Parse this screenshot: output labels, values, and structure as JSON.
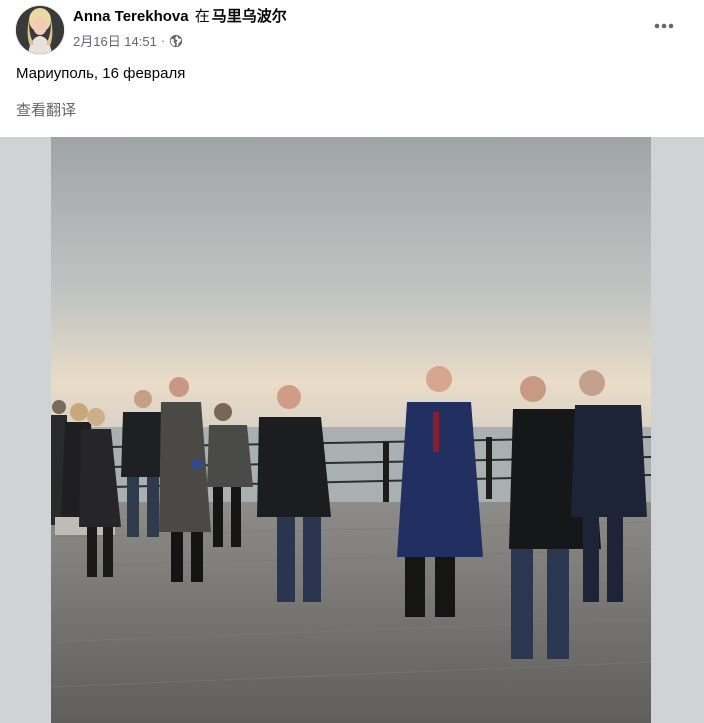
{
  "post": {
    "author": "Anna Terekhova",
    "in_word": "在",
    "location": "马里乌波尔",
    "date": "2月16日 14:51",
    "separator": "·",
    "privacy_icon": "globe-icon",
    "more_icon": "more-horizontal-icon",
    "text": "Мариуполь, 16 февраля",
    "translate_label": "查看翻译"
  },
  "colors": {
    "secondary_text": "#65676b",
    "primary_text": "#050505",
    "media_background": "#cfd3d6"
  }
}
